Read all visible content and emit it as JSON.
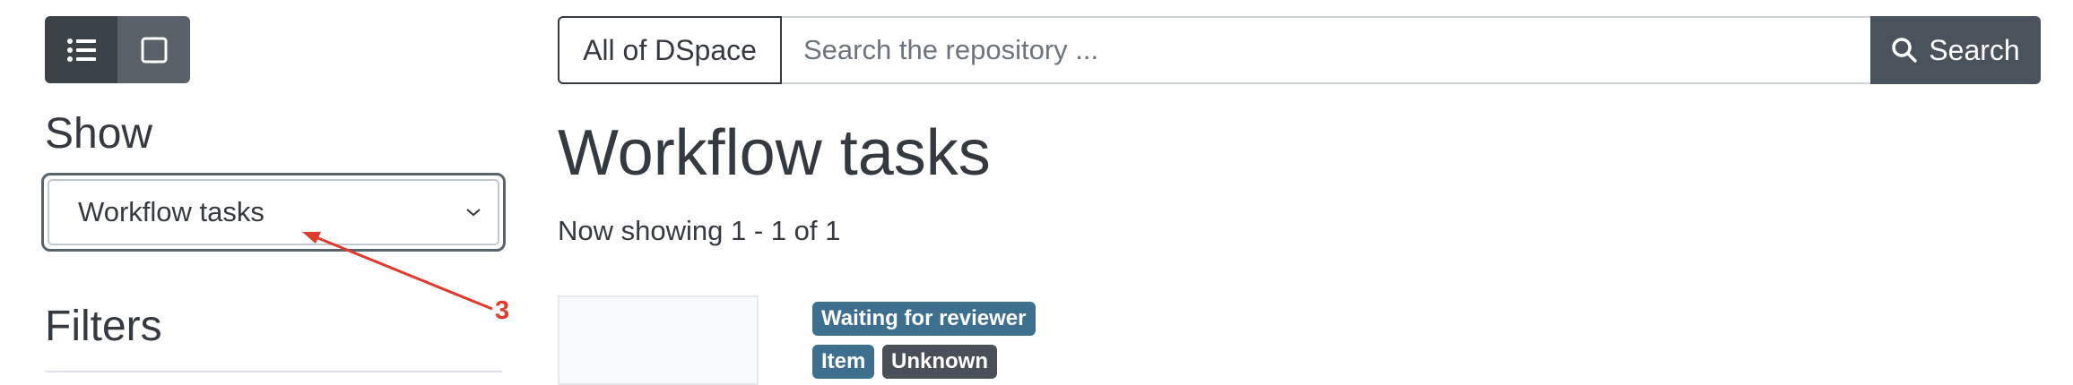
{
  "view_toggle": {
    "list_icon": "list-icon",
    "grid_icon": "grid-icon",
    "active": "list"
  },
  "sidebar": {
    "show_heading": "Show",
    "show_select": {
      "selected": "Workflow tasks",
      "icon": "chevron-down-icon"
    },
    "filters_heading": "Filters"
  },
  "search": {
    "scope_label": "All of DSpace",
    "placeholder": "Search the repository ...",
    "button_label": "Search",
    "button_icon": "search-icon"
  },
  "main": {
    "title": "Workflow tasks",
    "pagination": "Now showing 1 - 1 of 1",
    "result": {
      "status_badge": "Waiting for reviewer",
      "type_badge": "Item",
      "state_badge": "Unknown"
    }
  },
  "annotation": {
    "label": "3",
    "color": "#e03a2c"
  },
  "colors": {
    "primary_dark": "#343a40",
    "badge_info": "#3e6f8e",
    "badge_secondary": "#495057"
  }
}
